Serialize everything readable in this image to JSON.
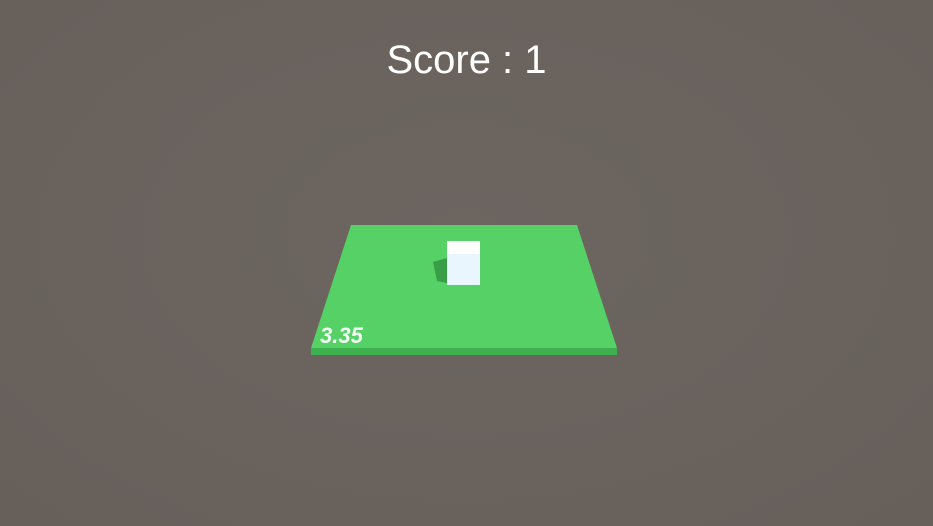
{
  "hud": {
    "score_text": "Score : 1",
    "timer_text": "3.35"
  },
  "colors": {
    "background": "#69625d",
    "platform_top": "#55d166",
    "platform_edge": "#3fb04f",
    "cube": "#eef8ff",
    "text": "#ffffff"
  },
  "scene": {
    "platform": "green-platform",
    "player": "white-cube"
  }
}
